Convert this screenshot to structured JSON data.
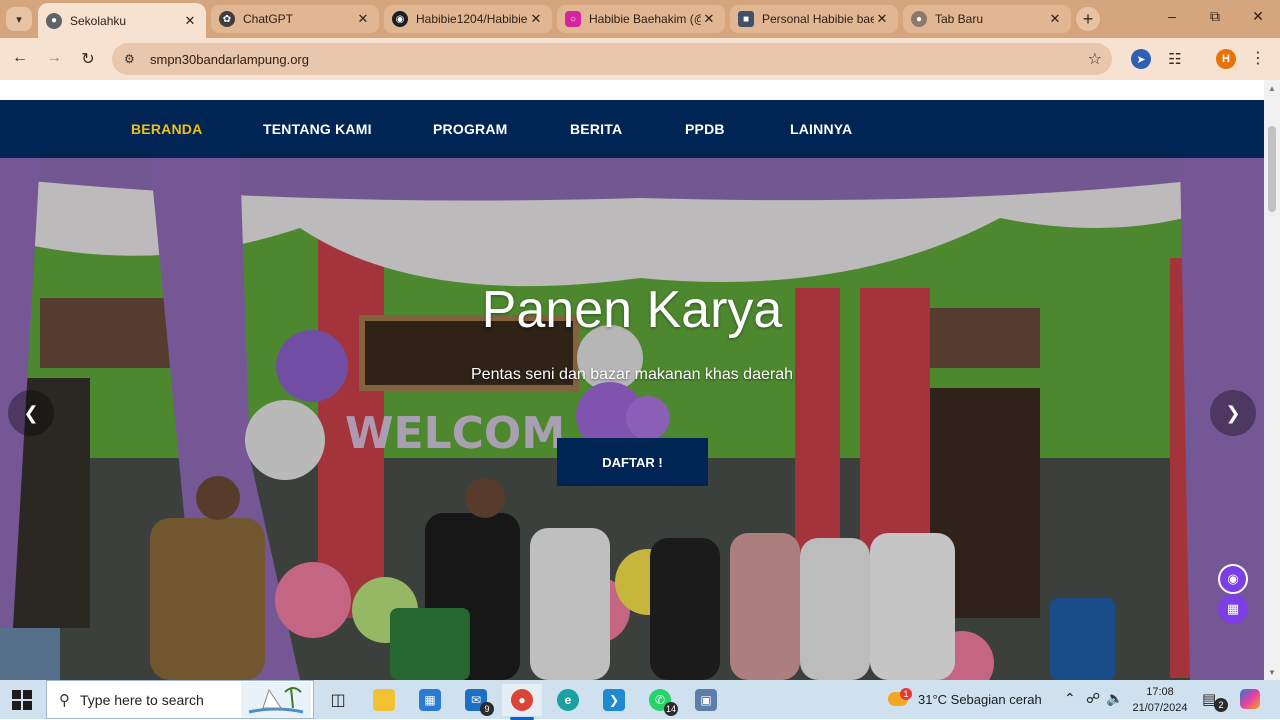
{
  "browser": {
    "tabs": [
      {
        "title": "Sekolahku",
        "active": true
      },
      {
        "title": "ChatGPT",
        "active": false
      },
      {
        "title": "Habibie1204/Habibie",
        "active": false
      },
      {
        "title": "Habibie Baehakim (@",
        "active": false
      },
      {
        "title": "Personal Habibie bae",
        "active": false
      },
      {
        "title": "Tab Baru",
        "active": false
      }
    ],
    "url": "smpn30bandarlampung.org",
    "profile_initial": "H",
    "accent_color": "#d5a57e"
  },
  "site": {
    "nav": [
      {
        "label": "BERANDA",
        "active": true
      },
      {
        "label": "TENTANG KAMI",
        "active": false
      },
      {
        "label": "PROGRAM",
        "active": false
      },
      {
        "label": "BERITA",
        "active": false
      },
      {
        "label": "PPDB",
        "active": false
      },
      {
        "label": "LAINNYA",
        "active": false
      }
    ],
    "nav_bg": "#002554",
    "nav_active_color": "#f3c00f",
    "hero": {
      "title": "Panen Karya",
      "subtitle": "Pentas seni dan bazar makanan khas daerah",
      "button": "DAFTAR !",
      "prev_icon": "chevron-left-icon",
      "next_icon": "chevron-right-icon"
    }
  },
  "taskbar": {
    "search_placeholder": "Type here to search",
    "badges": {
      "mail": "9",
      "whatsapp": "14",
      "notifications": "2"
    },
    "weather": "31°C  Sebagian cerah",
    "weather_alert": "1",
    "time": "17:08",
    "date": "21/07/2024"
  }
}
